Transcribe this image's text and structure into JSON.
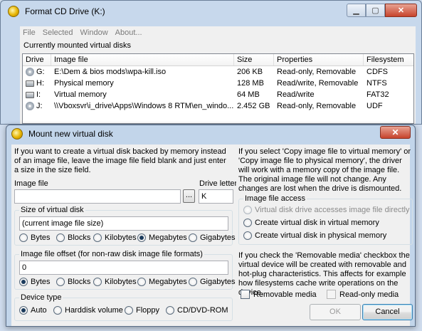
{
  "back_window": {
    "title": "Format CD Drive (K:)",
    "controls": {
      "minimize": "▁",
      "maximize": "▢",
      "close": "✕"
    },
    "menu": [
      "File",
      "Selected",
      "Window",
      "About..."
    ],
    "caption": "Currently mounted virtual disks",
    "columns": [
      "Drive",
      "Image file",
      "Size",
      "Properties",
      "Filesystem"
    ],
    "rows": [
      {
        "drive": "G:",
        "icon": "cd-disk-icon",
        "image": "E:\\Dem & bios mods\\wpa-kill.iso",
        "size": "206 KB",
        "properties": "Read-only, Removable",
        "fs": "CDFS"
      },
      {
        "drive": "H:",
        "icon": "hard-disk-icon",
        "image": "Physical memory",
        "size": "128 MB",
        "properties": "Read/write, Removable",
        "fs": "NTFS"
      },
      {
        "drive": "I:",
        "icon": "hard-disk-icon",
        "image": "Virtual memory",
        "size": "64 MB",
        "properties": "Read/write",
        "fs": "FAT32"
      },
      {
        "drive": "J:",
        "icon": "cd-disk-icon",
        "image": "\\\\Vboxsvr\\i_drive\\Apps\\Windows 8 RTM\\en_windo...",
        "size": "2.452 GB",
        "properties": "Read-only, Removable",
        "fs": "UDF"
      }
    ]
  },
  "dialog": {
    "title": "Mount new virtual disk",
    "close": "✕",
    "intro_left": "If you want to create a virtual disk backed by memory instead of an image file, leave the image file field blank and just enter a size in the size field.",
    "intro_right": "If you select 'Copy image file to virtual memory' or 'Copy image file to physical memory', the driver will work with a memory copy of the image file. The original image file will not change. Any changes are lost when the drive is dismounted.",
    "image_file_label": "Image file",
    "image_file_value": "",
    "browse_label": "...",
    "drive_letter_label": "Drive letter",
    "drive_letter_value": "K",
    "size_group": {
      "label": "Size of virtual disk",
      "value": "(current image file size)",
      "units": [
        "Bytes",
        "Blocks",
        "Kilobytes",
        "Megabytes",
        "Gigabytes"
      ],
      "selected": "Megabytes"
    },
    "offset_group": {
      "label": "Image file offset (for non-raw disk image file formats)",
      "value": "0",
      "units": [
        "Bytes",
        "Blocks",
        "Kilobytes",
        "Megabytes",
        "Gigabytes"
      ],
      "selected": "Bytes"
    },
    "device_group": {
      "label": "Device type",
      "options": [
        "Auto",
        "Harddisk volume",
        "Floppy",
        "CD/DVD-ROM"
      ],
      "selected": "Auto"
    },
    "access_group": {
      "label": "Image file access",
      "options": [
        {
          "label": "Virtual disk drive accesses image file directly",
          "disabled": true,
          "checked": false
        },
        {
          "label": "Create virtual disk in virtual memory",
          "disabled": false,
          "checked": false
        },
        {
          "label": "Create virtual disk in physical memory",
          "disabled": false,
          "checked": false
        }
      ]
    },
    "removable_note": "If you check the 'Removable media' checkbox the virtual device will be created with removable and hot-plug characteristics. This affects for example how filesystems cache write operations on the device.",
    "removable_label": "Removable media",
    "readonly_label": "Read-only media",
    "ok_label": "OK",
    "cancel_label": "Cancel"
  }
}
